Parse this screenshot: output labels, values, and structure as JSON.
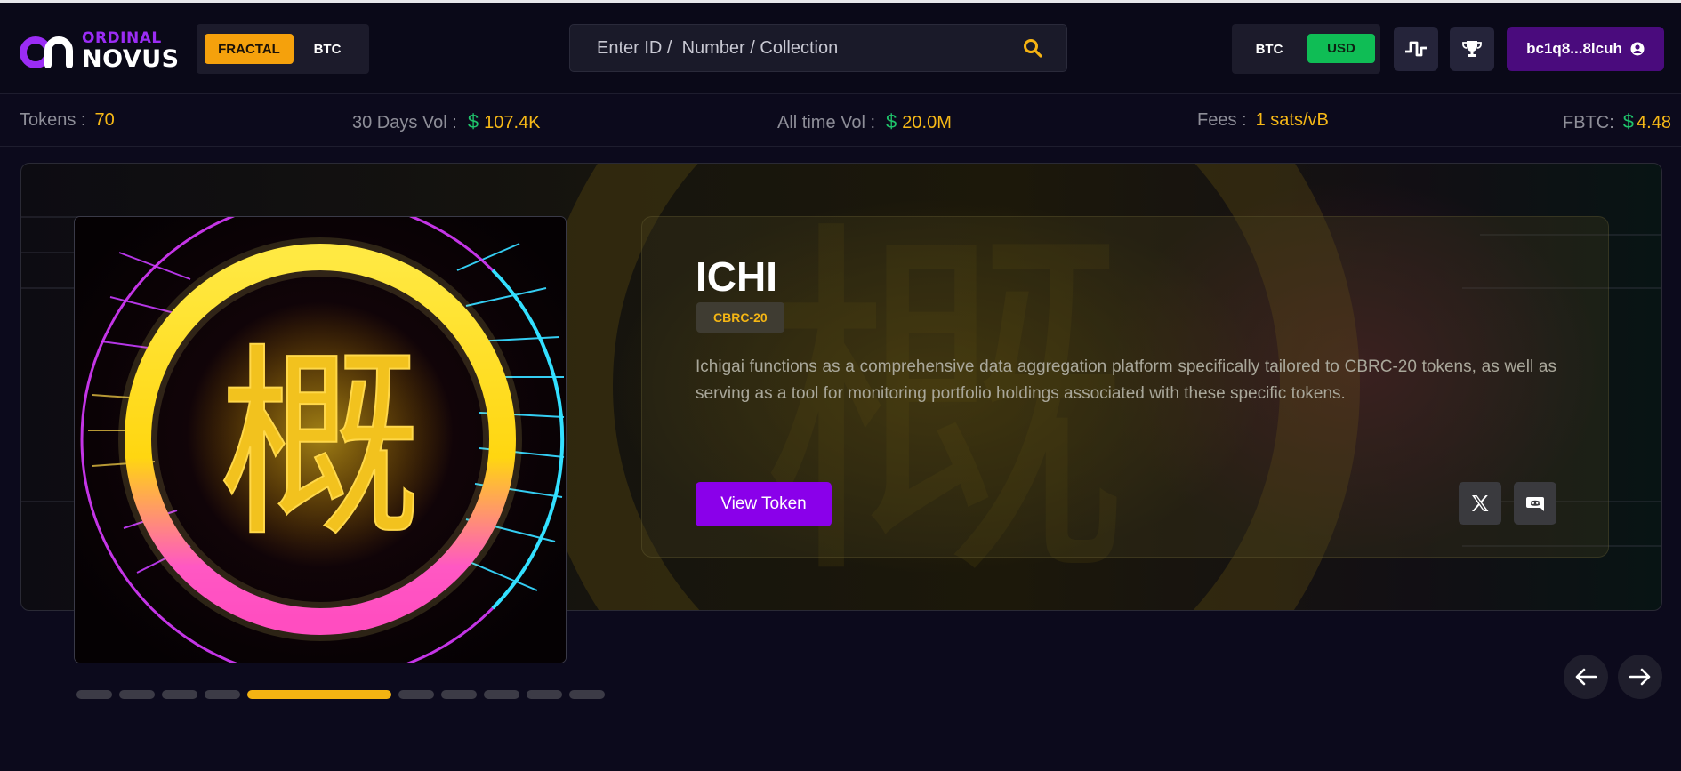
{
  "header": {
    "logo": {
      "top": "ORDINAL",
      "bottom": "NOVUS"
    },
    "network_toggle": {
      "active": "FRACTAL",
      "other": "BTC"
    },
    "search": {
      "placeholder": "Enter ID /  Number / Collection",
      "icon": "search-icon"
    },
    "currency_toggle": {
      "btc": "BTC",
      "usd": "USD",
      "selected": "USD"
    },
    "activity_button": {
      "icon": "activity-icon"
    },
    "trophy_button": {
      "icon": "trophy-icon"
    },
    "wallet": {
      "address": "bc1q8...8lcuh",
      "icon": "user-icon"
    }
  },
  "stats": {
    "tokens": {
      "label": "Tokens :",
      "value": "70"
    },
    "vol_30d": {
      "label": "30 Days Vol :",
      "currency": "$",
      "value": "107.4K"
    },
    "vol_all": {
      "label": "All time Vol :",
      "currency": "$",
      "value": "20.0M"
    },
    "fees": {
      "label": "Fees :",
      "value": "1 sats/vB"
    },
    "fbtc": {
      "label": "FBTC:",
      "currency": "$",
      "value": "4.48"
    }
  },
  "featured": {
    "title": "ICHI",
    "badge": "CBRC-20",
    "description": "Ichigai functions as a comprehensive data aggregation platform specifically tailored to CBRC-20 tokens, as well as serving as a tool for monitoring portfolio holdings associated with these specific tokens.",
    "image_glyph": "概",
    "view_button": "View Token",
    "socials": [
      "x-icon",
      "discord-icon"
    ]
  },
  "carousel": {
    "slide_count": 10,
    "active_index": 4
  },
  "colors": {
    "accent_purple": "#8a00ea",
    "accent_orange": "#f5a10c",
    "accent_green": "#0fbd55",
    "value_yellow": "#f7b917"
  }
}
